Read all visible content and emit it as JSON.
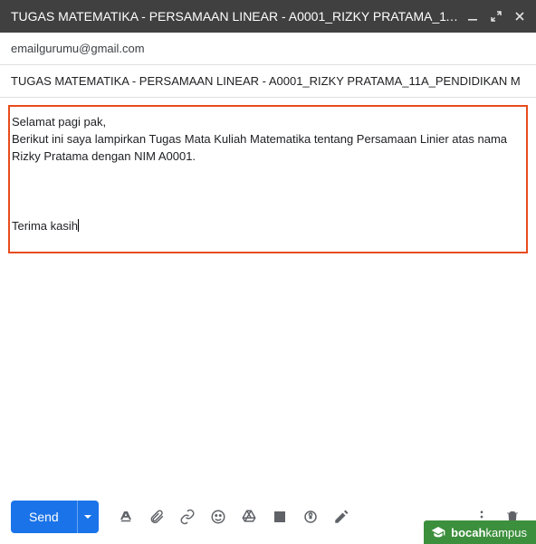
{
  "header": {
    "title": "TUGAS MATEMATIKA - PERSAMAAN LINEAR - A0001_RIZKY PRATAMA_11…"
  },
  "to": {
    "value": "emailgurumu@gmail.com"
  },
  "subject": {
    "value": "TUGAS MATEMATIKA - PERSAMAAN LINEAR - A0001_RIZKY PRATAMA_11A_PENDIDIKAN M"
  },
  "body": {
    "line1": "Selamat pagi pak,",
    "line2": "Berikut ini saya lampirkan Tugas Mata Kuliah Matematika tentang Persamaan Linier atas nama Rizky Pratama dengan NIM A0001.",
    "line3": "Terima kasih"
  },
  "toolbar": {
    "send_label": "Send"
  },
  "watermark": {
    "bold": "bocah",
    "thin": "kampus"
  }
}
